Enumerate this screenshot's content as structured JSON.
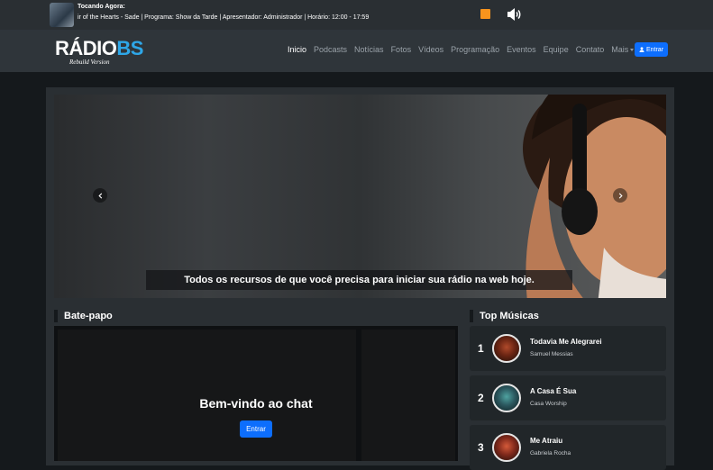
{
  "player": {
    "now_playing_label": "Tocando Agora:",
    "now_playing_text": "ir of the Hearts - Sade | Programa: Show da Tarde | Apresentador: Administrador | Horário: 12:00 - 17:59"
  },
  "brand": {
    "logo_main_a": "RÁDIO",
    "logo_main_b": "BS",
    "logo_sub": "Rebuild Version",
    "accent": "#2ea7e8"
  },
  "nav": {
    "items": [
      "Inicio",
      "Podcasts",
      "Notícias",
      "Fotos",
      "Vídeos",
      "Programação",
      "Eventos",
      "Equipe",
      "Contato",
      "Mais"
    ],
    "login_label": "Entrar"
  },
  "hero": {
    "caption": "Todos os recursos de que você precisa para iniciar sua rádio na web hoje."
  },
  "chat": {
    "heading": "Bate-papo",
    "welcome": "Bem-vindo ao chat",
    "enter_label": "Entrar"
  },
  "top_songs": {
    "heading": "Top Músicas",
    "items": [
      {
        "rank": "1",
        "title": "Todavia Me Alegrarei",
        "artist": "Samuel Messias"
      },
      {
        "rank": "2",
        "title": "A Casa É Sua",
        "artist": "Casa Worship"
      },
      {
        "rank": "3",
        "title": "Me Atraiu",
        "artist": "Gabriela Rocha"
      }
    ]
  },
  "colors": {
    "primary_button": "#0d6efd",
    "stop_button": "#f7941d",
    "background": "#15191c",
    "panel": "#2a2f33"
  }
}
